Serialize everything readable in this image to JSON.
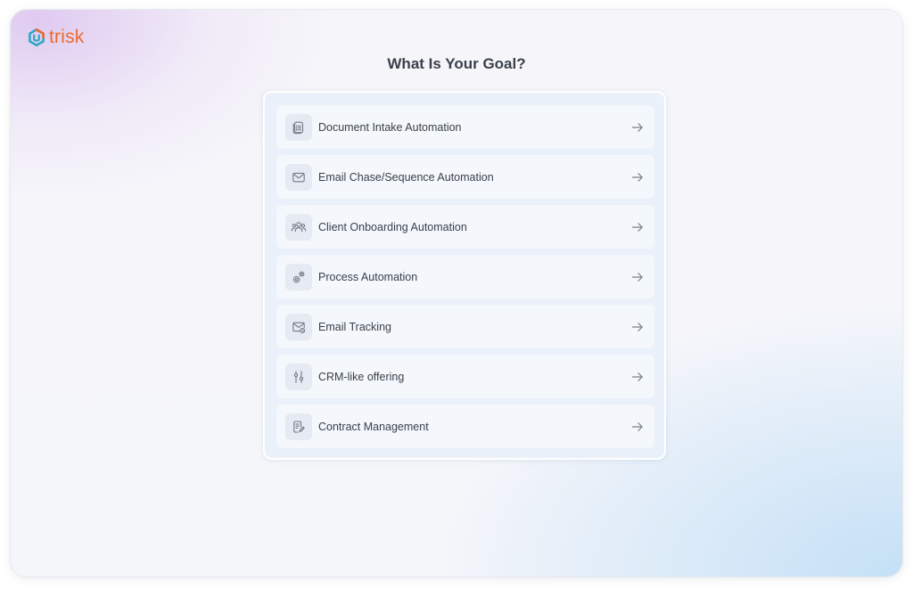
{
  "brand": {
    "name": "trisk",
    "color": "#ef6a2b",
    "mark_color": "#2fa8c4"
  },
  "page": {
    "title": "What Is Your Goal?"
  },
  "options": [
    {
      "label": "Document Intake Automation",
      "icon": "document-icon"
    },
    {
      "label": "Email Chase/Sequence Automation",
      "icon": "envelope-icon"
    },
    {
      "label": "Client Onboarding Automation",
      "icon": "users-icon"
    },
    {
      "label": "Process Automation",
      "icon": "gears-icon"
    },
    {
      "label": "Email Tracking",
      "icon": "envelope-clock-icon"
    },
    {
      "label": "CRM-like offering",
      "icon": "sliders-icon"
    },
    {
      "label": "Contract Management",
      "icon": "contract-icon"
    }
  ],
  "colors": {
    "text": "#3b404b",
    "icon": "#707786",
    "arrow": "#7a8090"
  }
}
